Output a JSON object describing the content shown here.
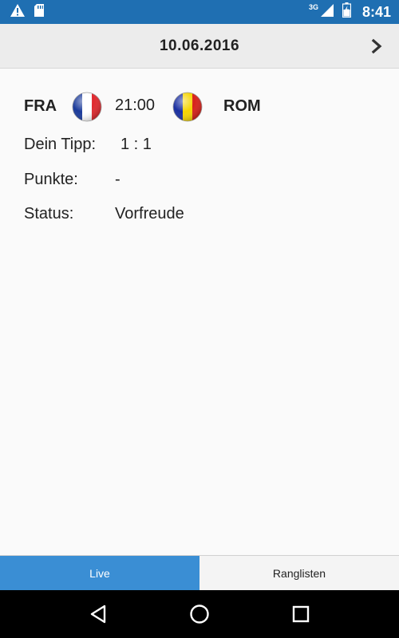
{
  "status_bar": {
    "time": "8:41",
    "network": "3G"
  },
  "header": {
    "date": "10.06.2016"
  },
  "match": {
    "home_team": "FRA",
    "away_team": "ROM",
    "kickoff": "21:00"
  },
  "details": {
    "tip_label": "Dein Tipp:",
    "tip_value": "1 : 1",
    "points_label": "Punkte:",
    "points_value": "-",
    "status_label": "Status:",
    "status_value": "Vorfreude"
  },
  "tabs": [
    {
      "label": "Live",
      "active": true
    },
    {
      "label": "Ranglisten",
      "active": false
    }
  ],
  "colors": {
    "status_bar": "#1f6fb2",
    "active_tab": "#3a8ed4",
    "flag_france": [
      "#1a3a9a",
      "#ffffff",
      "#e0282e"
    ],
    "flag_romania": [
      "#1a2fa0",
      "#f5d400",
      "#d8201a"
    ]
  },
  "icons": {
    "status_left": [
      "warning-icon",
      "sd-card-icon"
    ],
    "status_right": [
      "signal-icon",
      "battery-icon"
    ],
    "header": "chevron-right-icon",
    "nav": [
      "back-icon",
      "home-icon",
      "recents-icon"
    ]
  }
}
